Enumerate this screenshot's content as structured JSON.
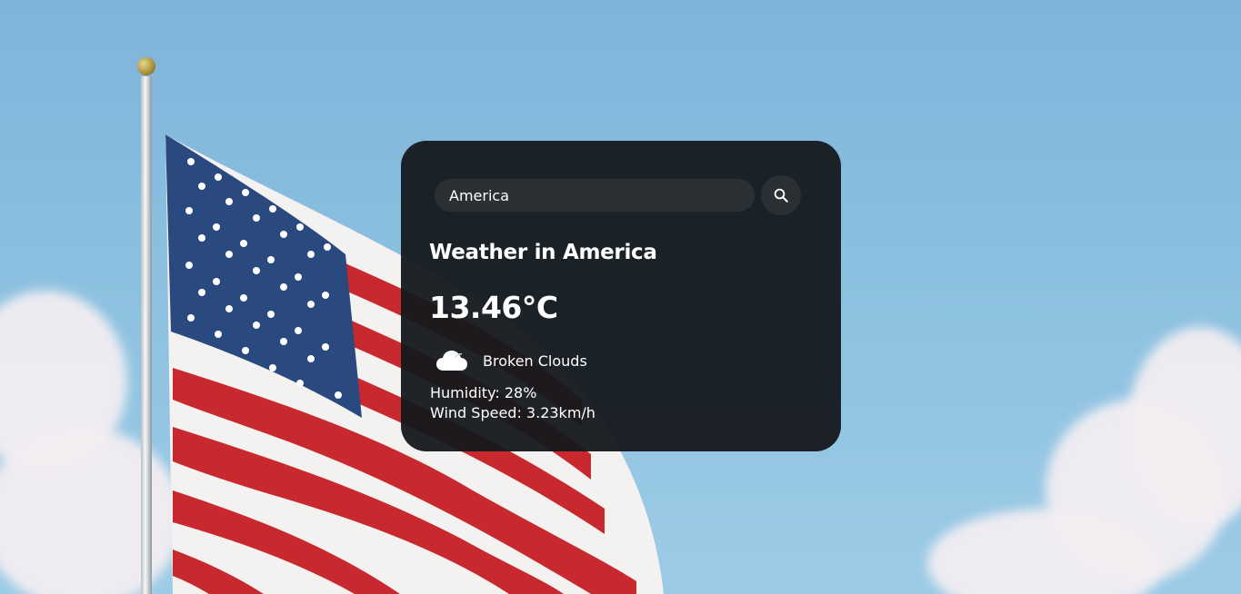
{
  "search": {
    "value": "America",
    "button_icon": "search-icon"
  },
  "weather": {
    "title": "Weather in America",
    "temperature": "13.46°C",
    "description": "Broken Clouds",
    "description_icon": "cloud-icon",
    "humidity": "Humidity: 28%",
    "wind": "Wind Speed: 3.23km/h"
  },
  "background": {
    "icon": "american-flag-image"
  }
}
